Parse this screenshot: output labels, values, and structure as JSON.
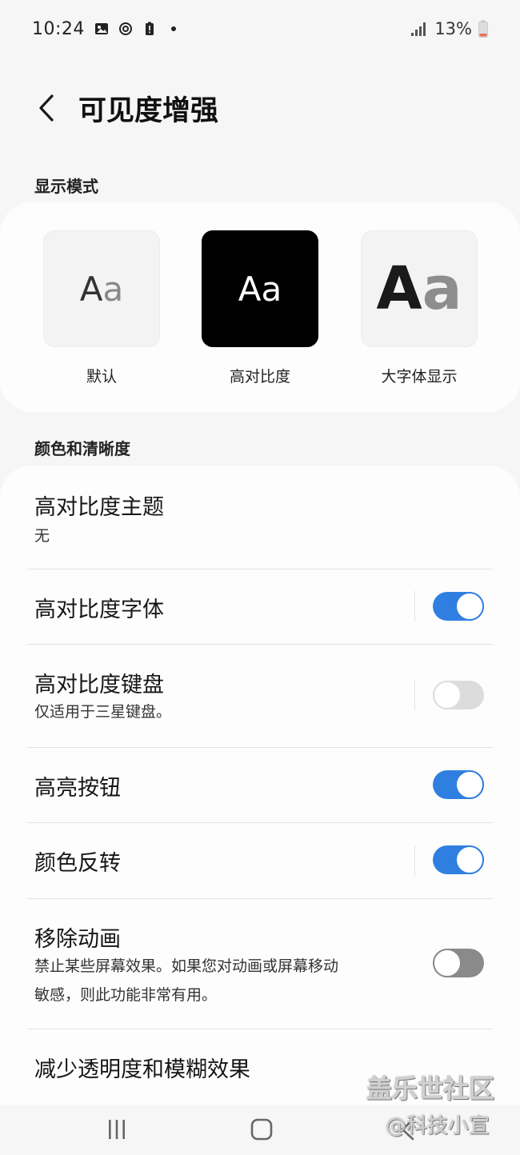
{
  "status_bar": {
    "time": "10:24",
    "battery": "13%",
    "icons": [
      "gallery-icon",
      "sync-icon",
      "battery-alert-icon",
      "dot-icon",
      "signal-icon",
      "battery-icon"
    ]
  },
  "header": {
    "back_icon": "chevron-left-icon",
    "title": "可见度增强"
  },
  "display_mode": {
    "section_label": "显示模式",
    "options": [
      {
        "name": "默认",
        "sample": "Aa",
        "selected": false
      },
      {
        "name": "高对比度",
        "sample": "Aa",
        "selected": true
      },
      {
        "name": "大字体显示",
        "sample": "Aa",
        "selected": false
      }
    ]
  },
  "color_clarity": {
    "section_label": "颜色和清晰度",
    "items": [
      {
        "title": "高对比度主题",
        "subtitle": "无"
      },
      {
        "title": "高对比度字体",
        "toggle": "on"
      },
      {
        "title": "高对比度键盘",
        "subtitle": "仅适用于三星键盘。",
        "toggle": "off"
      },
      {
        "title": "高亮按钮",
        "toggle": "on"
      },
      {
        "title": "颜色反转",
        "toggle": "on"
      },
      {
        "title": "移除动画",
        "subtitle_line1": "禁止某些屏幕效果。如果您对动画或屏幕移动",
        "subtitle_line2": "敏感，则此功能非常有用。",
        "toggle": "off"
      },
      {
        "title": "减少透明度和模糊效果"
      }
    ]
  },
  "nav_bar": {
    "icons": [
      "recents-icon",
      "home-icon",
      "back-icon"
    ]
  },
  "watermark": {
    "line1": "盖乐世社区",
    "line2": "@科技小宣"
  },
  "colors": {
    "accent": "#2f7fe0",
    "background": "#f6f6f6",
    "card": "#fdfdfd"
  }
}
